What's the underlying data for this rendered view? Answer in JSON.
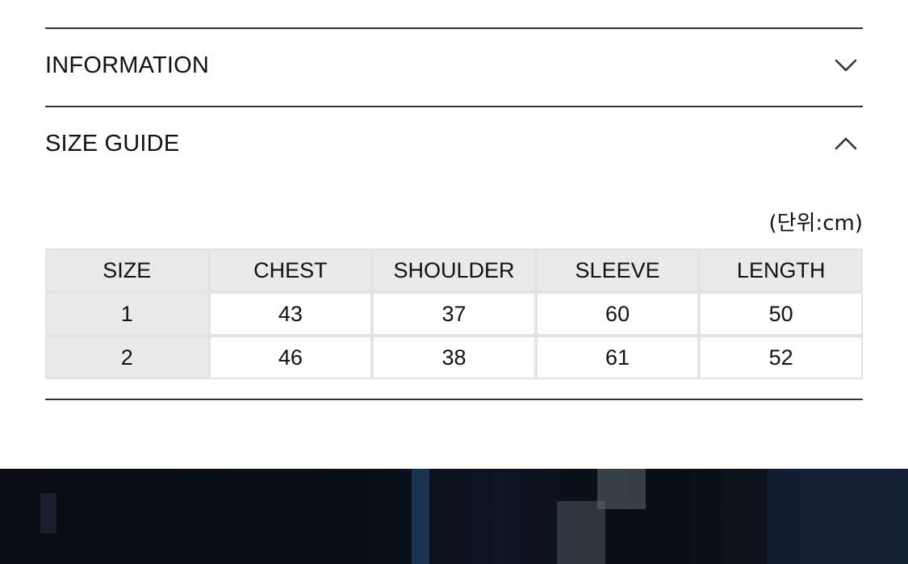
{
  "sections": {
    "information": {
      "title": "INFORMATION",
      "icon": "chevron-down-icon",
      "expanded": false
    },
    "size_guide": {
      "title": "SIZE GUIDE",
      "icon": "chevron-up-icon",
      "expanded": true
    }
  },
  "size_table": {
    "unit": "(단위:cm)",
    "headers": [
      "SIZE",
      "CHEST",
      "SHOULDER",
      "SLEEVE",
      "LENGTH"
    ],
    "rows": [
      [
        "1",
        "43",
        "37",
        "60",
        "50"
      ],
      [
        "2",
        "46",
        "38",
        "61",
        "52"
      ]
    ]
  },
  "colors": {
    "rule": "#333333",
    "header_bg": "#e9e9e9",
    "cell_border": "#e3e3e3"
  }
}
